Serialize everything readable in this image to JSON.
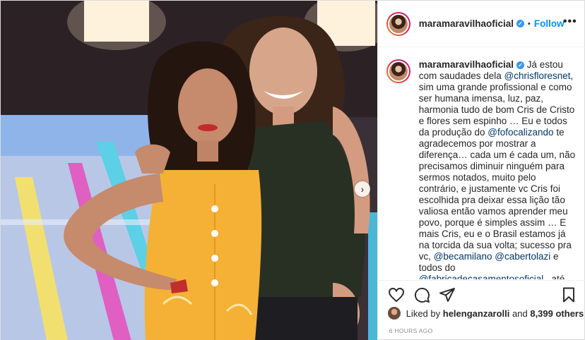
{
  "post": {
    "username": "maramaravilhaoficial",
    "verified": true,
    "follow_label": "Follow",
    "separator": "•",
    "more_label": "•••",
    "next_label": "›",
    "caption": {
      "username": "maramaravilhaoficial",
      "segments": [
        {
          "text": "Já estou com saudades dela ",
          "mention": false
        },
        {
          "text": "@chrisfloresnet",
          "mention": true
        },
        {
          "text": ", sim uma grande profissional e como ser humana imensa, luz, paz, harmonia tudo de bom Cris de Cristo e flores sem espinho … Eu e todos da produção do ",
          "mention": false
        },
        {
          "text": "@fofocalizando",
          "mention": true
        },
        {
          "text": " te agradecemos por mostrar a diferença… cada um é cada um, não precisamos diminuir ninguém para sermos notados, muito pelo contrário, e justamente vc Cris foi escolhida pra deixar essa lição tão valiosa então vamos aprender meu povo, porque é simples assim … E mais Cris, eu e o Brasil estamos já na torcida da sua volta; sucesso pra vc, ",
          "mention": false
        },
        {
          "text": "@becamilano",
          "mention": true
        },
        {
          "text": " ",
          "mention": false
        },
        {
          "text": "@cabertolazi",
          "mention": true
        },
        {
          "text": " e todos do ",
          "mention": false
        },
        {
          "text": "@fabricadecasamentosoficial",
          "mention": true
        },
        {
          "text": " , até",
          "mention": false
        }
      ]
    },
    "likes": {
      "prefix": "Liked by ",
      "user": "helenganzarolli",
      "middle": " and ",
      "others": "8,399 others"
    },
    "timestamp": "6 HOURS AGO",
    "icons": [
      "heart-icon",
      "comment-icon",
      "share-icon",
      "bookmark-icon"
    ],
    "colors": {
      "link": "#0095f6",
      "mention": "#00376b",
      "verified": "#3897f0",
      "muted": "#8e8e8e"
    }
  }
}
